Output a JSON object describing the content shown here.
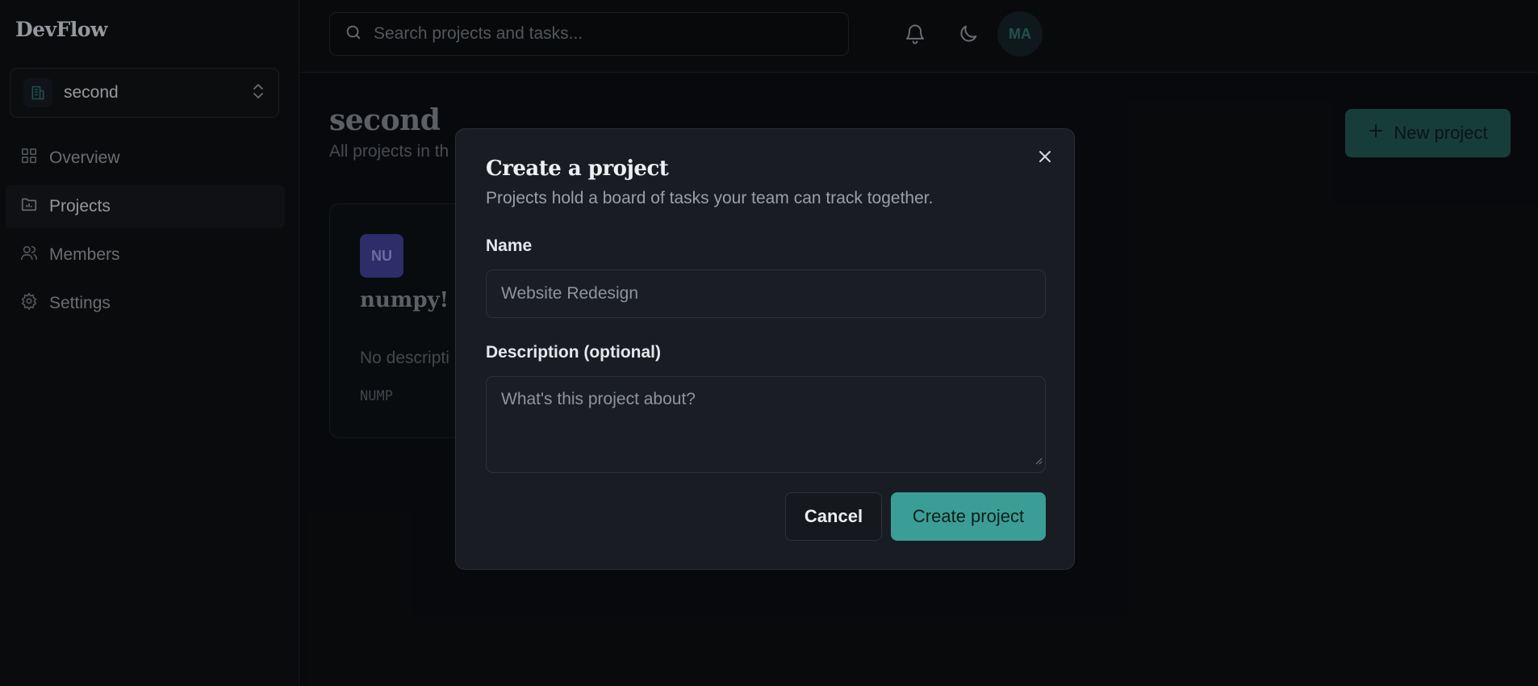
{
  "app": {
    "name": "DevFlow"
  },
  "workspace": {
    "name": "second"
  },
  "sidebar": {
    "items": [
      {
        "label": "Overview",
        "icon": "grid-icon"
      },
      {
        "label": "Projects",
        "icon": "folder-icon",
        "active": true
      },
      {
        "label": "Members",
        "icon": "users-icon"
      },
      {
        "label": "Settings",
        "icon": "gear-icon"
      }
    ]
  },
  "topbar": {
    "search_placeholder": "Search projects and tasks...",
    "avatar_initials": "MA"
  },
  "main": {
    "title": "second",
    "subtitle": "All projects in th",
    "new_project_label": "New project"
  },
  "project_card": {
    "badge": "NU",
    "name": "numpy!",
    "description": "No descripti",
    "key": "NUMP"
  },
  "modal": {
    "title": "Create a project",
    "description": "Projects hold a board of tasks your team can track together.",
    "name_label": "Name",
    "name_placeholder": "Website Redesign",
    "description_label": "Description (optional)",
    "description_placeholder": "What's this project about?",
    "cancel_label": "Cancel",
    "create_label": "Create project"
  },
  "colors": {
    "accent": "#3a9e96",
    "background": "#0b0d10",
    "modal_background": "#191c22",
    "project_badge": "#3b3d8c"
  }
}
